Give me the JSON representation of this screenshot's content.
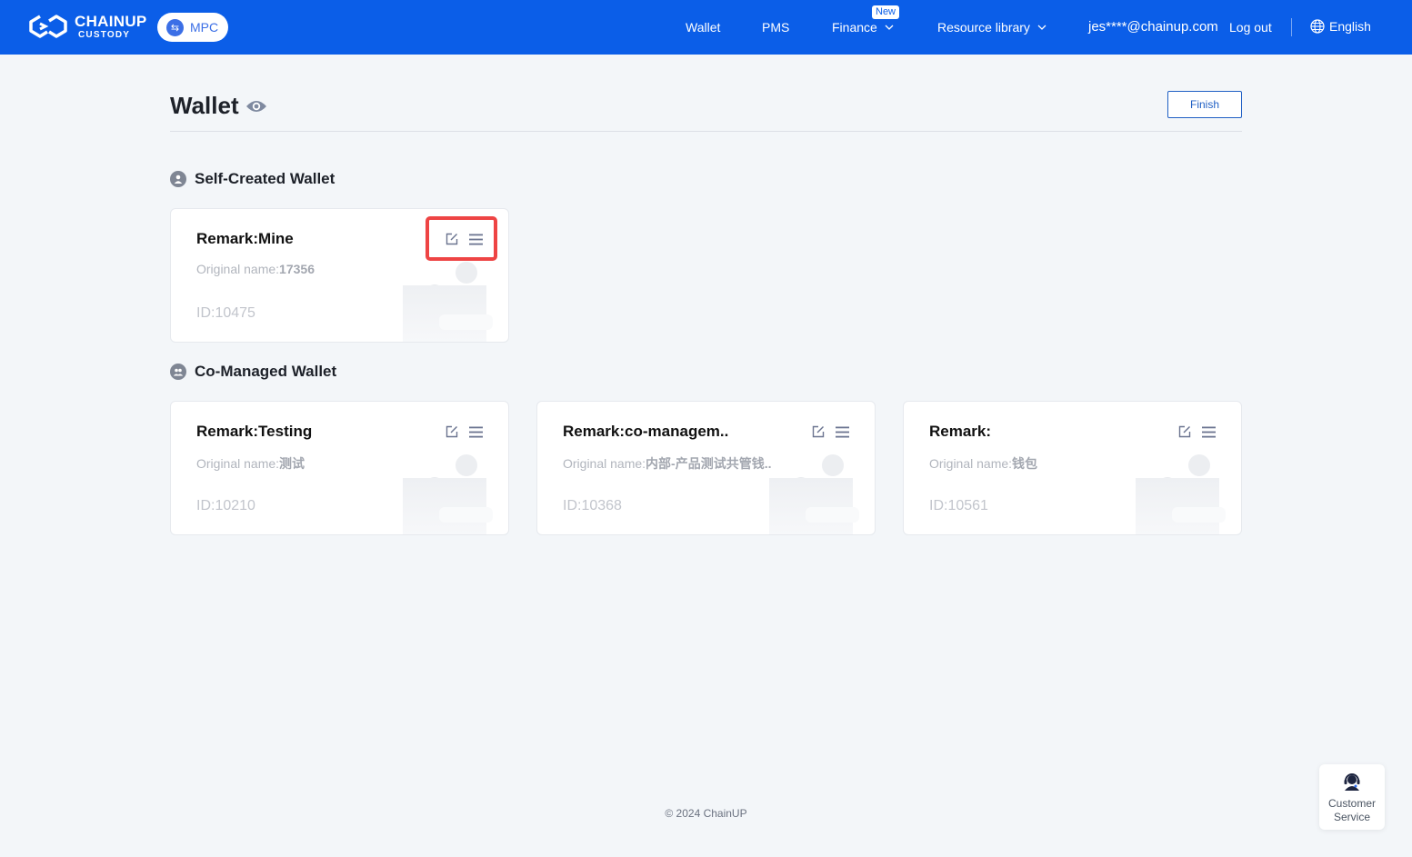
{
  "header": {
    "logo_text": "CHAINUP",
    "logo_sub": "CUSTODY",
    "mode_badge": "MPC",
    "nav": [
      {
        "label": "Wallet"
      },
      {
        "label": "PMS"
      },
      {
        "label": "Finance",
        "badge": "New",
        "has_dropdown": true
      },
      {
        "label": "Resource library",
        "has_dropdown": true
      }
    ],
    "user_email": "jes****@chainup.com",
    "logout": "Log out",
    "language": "English",
    "accent_color": "#0b5ee8"
  },
  "page": {
    "title": "Wallet",
    "finish_button": "Finish"
  },
  "self_created": {
    "title": "Self-Created Wallet",
    "wallets": [
      {
        "remark": "Remark:Mine",
        "original_label": "Original name:",
        "original_value": "17356",
        "id": "ID:10475"
      }
    ]
  },
  "co_managed": {
    "title": "Co-Managed Wallet",
    "wallets": [
      {
        "remark": "Remark:Testing",
        "original_label": "Original name:",
        "original_value": "测试",
        "id": "ID:10210"
      },
      {
        "remark": "Remark:co-managem..",
        "original_label": "Original name:",
        "original_value": "内部-产品测试共管钱..",
        "id": "ID:10368"
      },
      {
        "remark": "Remark:",
        "original_label": "Original name:",
        "original_value": "钱包",
        "id": "ID:10561"
      }
    ]
  },
  "footer": {
    "copyright": "© 2024 ChainUP"
  },
  "customer_service": {
    "line1": "Customer",
    "line2": "Service"
  },
  "icons": {
    "edit": "edit-icon",
    "menu": "menu-icon",
    "eye": "eye-icon",
    "globe": "globe-icon",
    "headset": "headset-icon"
  },
  "highlight_color": "#ee4444"
}
